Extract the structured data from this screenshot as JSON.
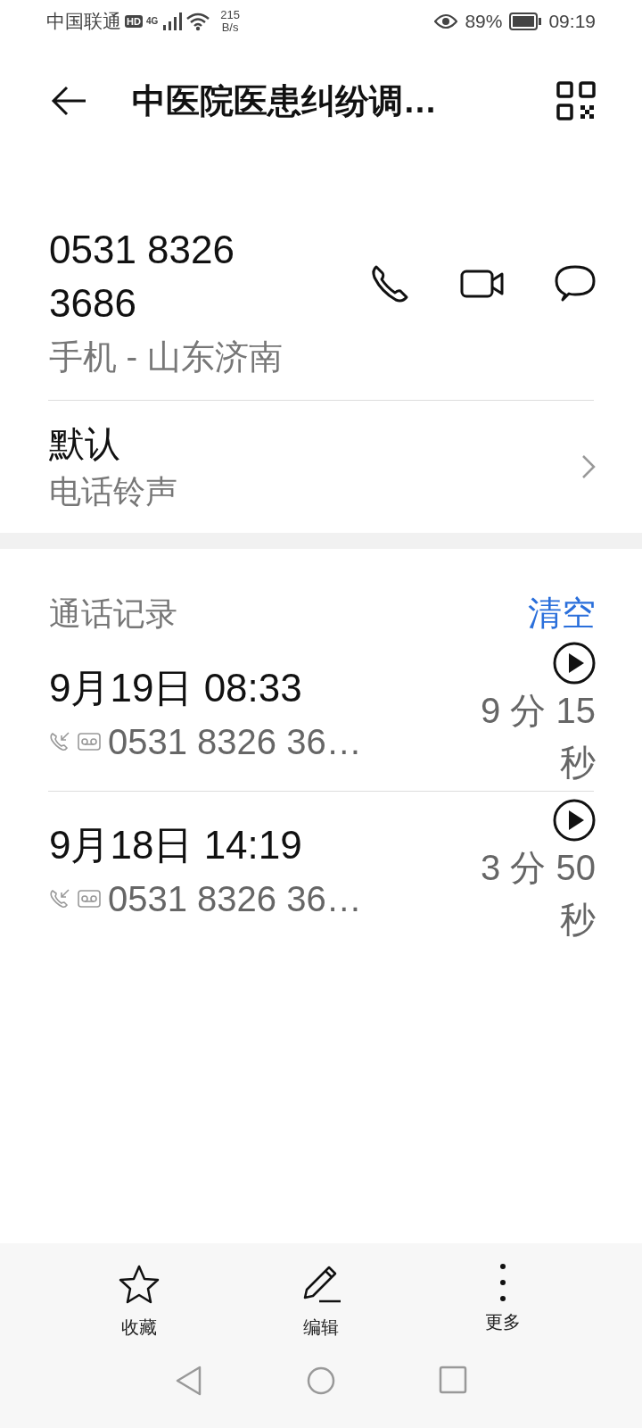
{
  "status_bar": {
    "carrier": "中国联通",
    "hd": "HD",
    "network": "4G",
    "speed_value": "215",
    "speed_unit": "B/s",
    "battery_percent": "89%",
    "time": "09:19"
  },
  "header": {
    "title": "中医院医患纠纷调…"
  },
  "contact": {
    "number": "0531 8326 3686",
    "label": "手机 - 山东济南"
  },
  "ringtone": {
    "value": "默认",
    "label": "电话铃声"
  },
  "call_log": {
    "title": "通话记录",
    "clear": "清空",
    "entries": [
      {
        "datetime": "9月19日 08:33",
        "number": "0531 8326 36…",
        "duration": "9 分 15 秒",
        "recorded": true
      },
      {
        "datetime": "9月18日 14:19",
        "number": "0531 8326 36…",
        "duration": "3 分 50 秒",
        "recorded": true
      }
    ]
  },
  "actions": [
    {
      "kind": "star",
      "label": "收藏"
    },
    {
      "kind": "edit",
      "label": "编辑"
    },
    {
      "kind": "more",
      "label": "更多"
    }
  ]
}
